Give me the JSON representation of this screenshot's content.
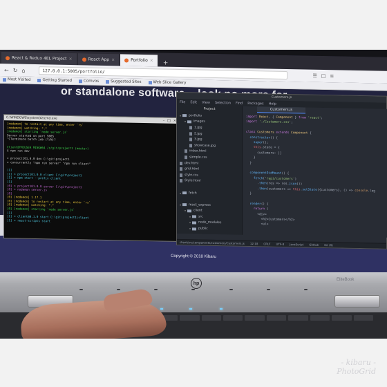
{
  "browser": {
    "tabs": [
      {
        "label": "React & Redux 4EL Project",
        "active": false
      },
      {
        "label": "React App",
        "active": false
      },
      {
        "label": "Portfolio",
        "active": true
      }
    ],
    "new_tab_symbol": "+",
    "url": "127.0.0.1:5005/portfolio/",
    "bookmarks": [
      "Most Visited",
      "Getting Started",
      "Comvos",
      "Suggested Sites",
      "Web Slice Gallery"
    ]
  },
  "page": {
    "hero_text": "or standalone software... look no more for",
    "copyright": "Copyright © 2018 Kibaru"
  },
  "terminal": {
    "title": "C:\\WINDOWS\\system32\\cmd.exe",
    "lines": [
      {
        "text": "[nodemon] to restart at any time, enter `rs`",
        "cls": "y"
      },
      {
        "text": "[nodemon] watching: *.*",
        "cls": "y"
      },
      {
        "text": "[nodemon] starting `node server.js`",
        "cls": "g"
      },
      {
        "text": "Server started on port 5005",
        "cls": ""
      },
      {
        "text": "^CTerminate batch job (Y/N)?",
        "cls": ""
      },
      {
        "text": "",
        "cls": ""
      },
      {
        "text": "Client@TMCUSER MINGW64 /c/git/project1 (master)",
        "cls": "g"
      },
      {
        "text": "$ npm run dev",
        "cls": ""
      },
      {
        "text": "",
        "cls": ""
      },
      {
        "text": "> project101.0.0 dev C:\\git\\project1",
        "cls": ""
      },
      {
        "text": "> concurrently \"npm run server\" \"npm run client\"",
        "cls": ""
      },
      {
        "text": "",
        "cls": ""
      },
      {
        "text": "[1]",
        "cls": "c"
      },
      {
        "text": "[1] > project101.0.0 client C:\\git\\project1",
        "cls": "c"
      },
      {
        "text": "[1] > npm start --prefix client",
        "cls": "c"
      },
      {
        "text": "[1]",
        "cls": "c"
      },
      {
        "text": "[0] > project101.0.0 server C:\\git\\project1",
        "cls": "m"
      },
      {
        "text": "[0] > nodemon server.js",
        "cls": "m"
      },
      {
        "text": "[0]",
        "cls": "m"
      },
      {
        "text": "[0] [nodemon] 1.17.1",
        "cls": "y"
      },
      {
        "text": "[0] [nodemon] to restart at any time, enter `rs`",
        "cls": "y"
      },
      {
        "text": "[0] [nodemon] watching: *.*",
        "cls": "y"
      },
      {
        "text": "[0] [nodemon] starting `node server.js`",
        "cls": "g"
      },
      {
        "text": "[1]",
        "cls": "c"
      },
      {
        "text": "[1] > client@0.1.0 start C:\\git\\project1\\client",
        "cls": "c"
      },
      {
        "text": "[1] > react-scripts start",
        "cls": "c"
      }
    ]
  },
  "atom": {
    "title": "Customers.js",
    "menu": [
      "File",
      "Edit",
      "View",
      "Selection",
      "Find",
      "Packages",
      "Help"
    ],
    "project_label": "Project",
    "tree": [
      {
        "label": "portfolio",
        "kind": "folder",
        "indent": 0
      },
      {
        "label": "images",
        "kind": "folder",
        "indent": 1
      },
      {
        "label": "1.jpg",
        "kind": "file",
        "indent": 2
      },
      {
        "label": "2.jpg",
        "kind": "file",
        "indent": 2
      },
      {
        "label": "3.jpg",
        "kind": "file",
        "indent": 2
      },
      {
        "label": "showcase.jpg",
        "kind": "file",
        "indent": 2
      },
      {
        "label": "index.html",
        "kind": "file",
        "indent": 1
      },
      {
        "label": "sample.css",
        "kind": "file",
        "indent": 1
      },
      {
        "label": "dev.html",
        "kind": "file",
        "indent": 0
      },
      {
        "label": "grid.html",
        "kind": "file",
        "indent": 0
      },
      {
        "label": "style.css",
        "kind": "file",
        "indent": 0
      },
      {
        "label": "Style.html",
        "kind": "file",
        "indent": 0
      },
      {
        "label": "",
        "kind": "blank",
        "indent": 0
      },
      {
        "label": "fetch",
        "kind": "folder",
        "indent": 0
      },
      {
        "label": "",
        "kind": "blank",
        "indent": 0
      },
      {
        "label": "react_express",
        "kind": "folder",
        "indent": 0
      },
      {
        "label": "client",
        "kind": "folder",
        "indent": 1
      },
      {
        "label": "src",
        "kind": "folder",
        "indent": 2
      },
      {
        "label": "node_modules",
        "kind": "folder",
        "indent": 2
      },
      {
        "label": "public",
        "kind": "folder",
        "indent": 2
      }
    ],
    "tab": "Customers.js",
    "code": [
      [
        [
          "k",
          "import "
        ],
        [
          "t",
          "React"
        ],
        [
          "",
          ", { "
        ],
        [
          "t",
          "Component"
        ],
        [
          "",
          " } "
        ],
        [
          "k",
          "from "
        ],
        [
          "s",
          "'react'"
        ],
        [
          "",
          ";"
        ]
      ],
      [
        [
          "k",
          "import "
        ],
        [
          "s",
          "'./Customers.css'"
        ],
        [
          "",
          ";"
        ]
      ],
      [
        [
          "",
          ""
        ]
      ],
      [
        [
          "k",
          "class "
        ],
        [
          "t",
          "Customers "
        ],
        [
          "k",
          "extends "
        ],
        [
          "t",
          "Component"
        ],
        [
          "",
          " {"
        ]
      ],
      [
        [
          "",
          "  "
        ],
        [
          "f",
          "constructor"
        ],
        [
          "",
          "() {"
        ]
      ],
      [
        [
          "",
          "    "
        ],
        [
          "f",
          "super"
        ],
        [
          "",
          "();"
        ]
      ],
      [
        [
          "",
          "    "
        ],
        [
          "r",
          "this"
        ],
        [
          "",
          ".state = {"
        ]
      ],
      [
        [
          "",
          "      customers: []"
        ]
      ],
      [
        [
          "",
          "    }"
        ]
      ],
      [
        [
          "",
          "  }"
        ]
      ],
      [
        [
          "",
          ""
        ]
      ],
      [
        [
          "",
          "  "
        ],
        [
          "f",
          "componentDidMount"
        ],
        [
          "",
          "() {"
        ]
      ],
      [
        [
          "",
          "    "
        ],
        [
          "f",
          "fetch"
        ],
        [
          "",
          "("
        ],
        [
          "s",
          "'/api/customers'"
        ],
        [
          "",
          ")"
        ]
      ],
      [
        [
          "",
          "      ."
        ],
        [
          "f",
          "then"
        ],
        [
          "",
          "(res => res."
        ],
        [
          "f",
          "json"
        ],
        [
          "",
          "())"
        ]
      ],
      [
        [
          "",
          "      ."
        ],
        [
          "f",
          "then"
        ],
        [
          "",
          "(customers => "
        ],
        [
          "r",
          "this"
        ],
        [
          "",
          "."
        ],
        [
          "f",
          "setState"
        ],
        [
          "",
          "({customers}, () => "
        ],
        [
          "o",
          "console"
        ],
        [
          "",
          ".log"
        ]
      ],
      [
        [
          "",
          "  }"
        ]
      ],
      [
        [
          "",
          ""
        ]
      ],
      [
        [
          "",
          "  "
        ],
        [
          "f",
          "render"
        ],
        [
          "",
          "() {"
        ]
      ],
      [
        [
          "",
          "    "
        ],
        [
          "k",
          "return"
        ],
        [
          "",
          " ("
        ]
      ],
      [
        [
          "",
          "      <div>"
        ]
      ],
      [
        [
          "",
          "        <h2>Customers</h2>"
        ]
      ],
      [
        [
          "",
          "        <ul>"
        ]
      ]
    ],
    "status": [
      "client/src/components/customers/Customers.js",
      "12:18",
      "CRLF",
      "UTF-8",
      "JavaScript",
      "GitHub",
      "Git (0)"
    ]
  },
  "laptop": {
    "logo": "hp",
    "model": "EliteBook"
  },
  "watermark": {
    "line1": "- kibaru -",
    "line2": "PhotoGrid"
  }
}
